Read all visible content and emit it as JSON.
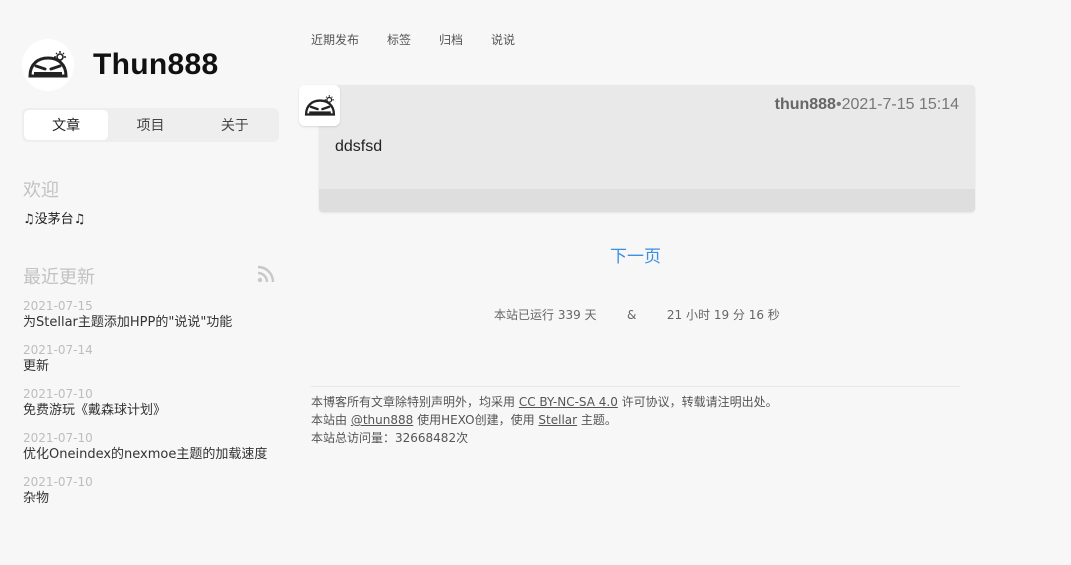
{
  "sidebar": {
    "site_title": "Thun888",
    "tabs": [
      {
        "label": "文章",
        "active": true
      },
      {
        "label": "项目",
        "active": false
      },
      {
        "label": "关于",
        "active": false
      }
    ],
    "welcome": {
      "title": "欢迎",
      "text": "♫没茅台♫"
    },
    "recent": {
      "title": "最近更新",
      "rss_icon": "rss-icon",
      "items": [
        {
          "date": "2021-07-15",
          "title": "为Stellar主题添加HPP的\"说说\"功能"
        },
        {
          "date": "2021-07-14",
          "title": "更新"
        },
        {
          "date": "2021-07-10",
          "title": "免费游玩《戴森球计划》"
        },
        {
          "date": "2021-07-10",
          "title": "优化Oneindex的nexmoe主题的加载速度"
        },
        {
          "date": "2021-07-10",
          "title": "杂物"
        }
      ]
    }
  },
  "nav": {
    "items": [
      "近期发布",
      "标签",
      "归档",
      "说说"
    ]
  },
  "talk": {
    "author": "thun888",
    "separator": "•",
    "time": "2021-7-15 15:14",
    "content": "ddsfsd"
  },
  "pagination": {
    "next_label": "下一页"
  },
  "runtime": {
    "text": "本站已运行 339 天        &        21 小时 19 分 16 秒"
  },
  "footer": {
    "line1_prefix": "本博客所有文章除特别声明外，均采用 ",
    "license_link": "CC BY-NC-SA 4.0",
    "line1_suffix": " 许可协议，转载请注明出处。",
    "line2_prefix": "本站由 ",
    "author_link": "@thun888",
    "line2_middle": " 使用HEXO创建，使用 ",
    "theme_link": "Stellar",
    "line2_suffix": " 主题。",
    "line3": "本站总访问量：32668482次"
  },
  "colors": {
    "accent_link": "#3a8ee6",
    "background": "#f7f7f7",
    "card": "#e9e9e9"
  }
}
